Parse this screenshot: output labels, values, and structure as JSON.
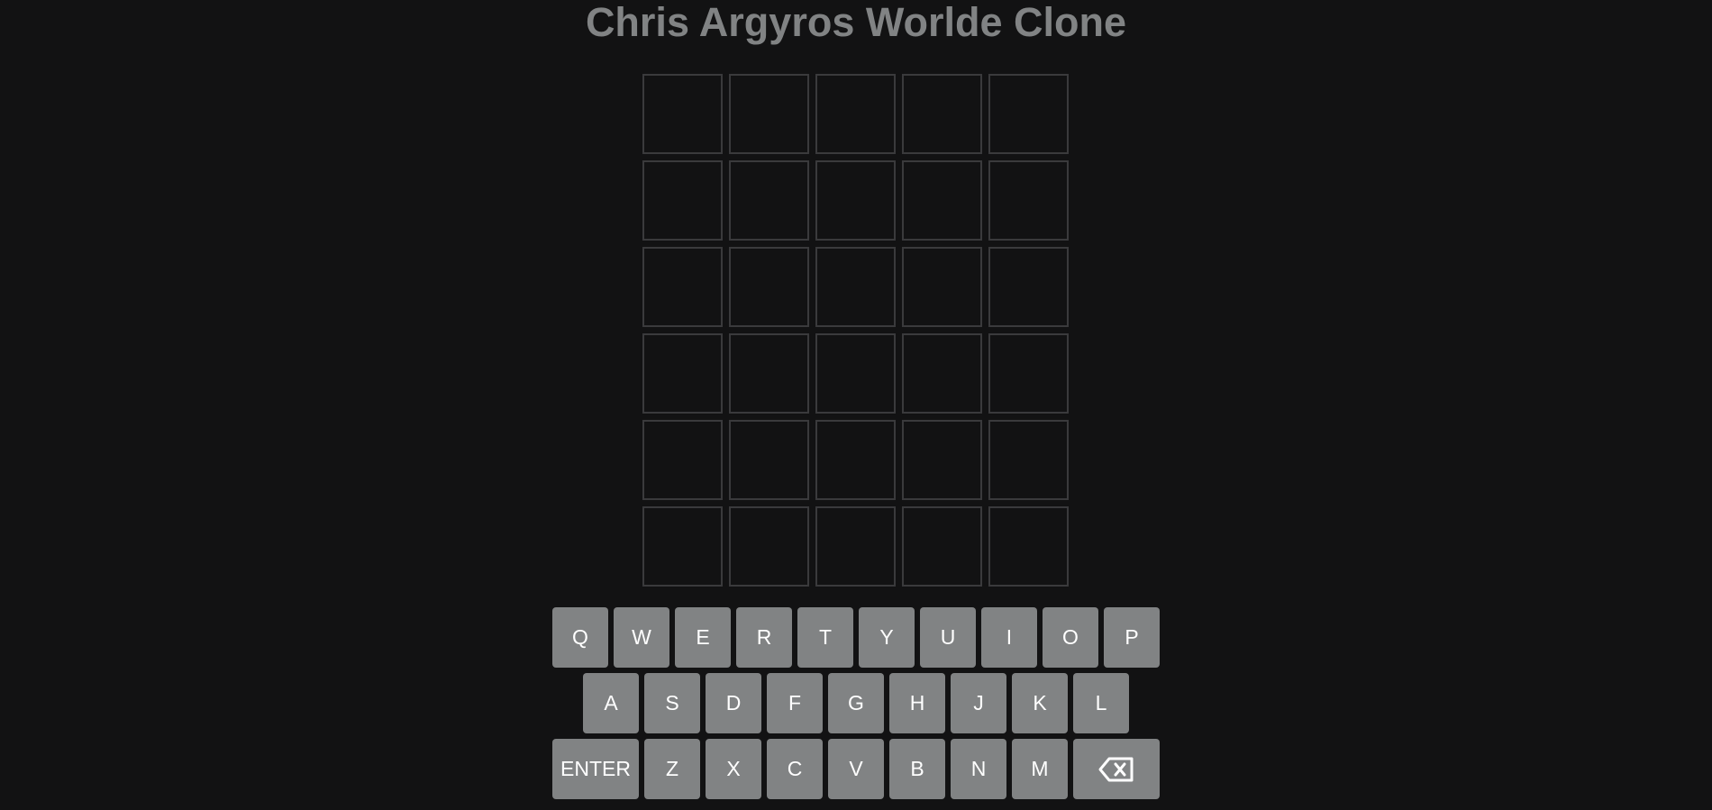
{
  "title": "Chris Argyros Worlde Clone",
  "colors": {
    "background": "#121213",
    "tile_border": "#3a3a3c",
    "key_background": "#818384",
    "key_text": "#ffffff",
    "title_text": "#818384"
  },
  "board": {
    "rows": [
      [
        "",
        "",
        "",
        "",
        ""
      ],
      [
        "",
        "",
        "",
        "",
        ""
      ],
      [
        "",
        "",
        "",
        "",
        ""
      ],
      [
        "",
        "",
        "",
        "",
        ""
      ],
      [
        "",
        "",
        "",
        "",
        ""
      ],
      [
        "",
        "",
        "",
        "",
        ""
      ]
    ]
  },
  "keyboard": {
    "rows": [
      [
        "Q",
        "W",
        "E",
        "R",
        "T",
        "Y",
        "U",
        "I",
        "O",
        "P"
      ],
      [
        "A",
        "S",
        "D",
        "F",
        "G",
        "H",
        "J",
        "K",
        "L"
      ],
      [
        "Z",
        "X",
        "C",
        "V",
        "B",
        "N",
        "M"
      ]
    ],
    "enter_label": "ENTER",
    "backspace_icon": "backspace-icon"
  }
}
